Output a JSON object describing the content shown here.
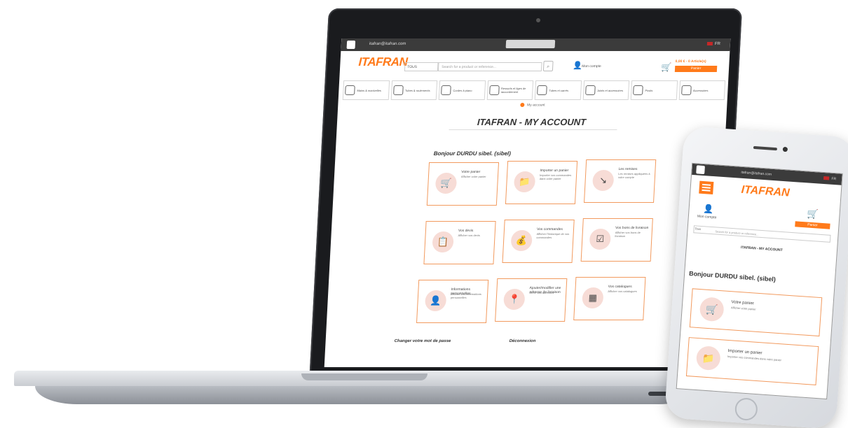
{
  "laptop": {
    "topbar": {
      "email": "itafran@itafran.com",
      "lang": "FR"
    },
    "brand": "ITAFRAN",
    "search": {
      "select": "TOUS",
      "placeholder": "Search for a product or reference..."
    },
    "account_label": "Mon compte",
    "cart": {
      "amount": "0,00 € · 0 Article(s)",
      "button": "Panier"
    },
    "categories": [
      "Mains & manivelles",
      "Tubes & roulements",
      "Cordes à piano",
      "Ressorts et tiges de raccordement",
      "Tubes et carrés",
      "Joints et accessoires",
      "Pivots",
      "Accessoires"
    ],
    "breadcrumb": "My account",
    "page_title": "ITAFRAN - MY ACCOUNT",
    "greeting": "Bonjour DURDU sibel. (sibel)",
    "tiles": [
      {
        "title": "Votre panier",
        "desc": "Afficher votre panier",
        "icon": "cart-icon",
        "glyph": "🛒"
      },
      {
        "title": "Importer un panier",
        "desc": "Importer vos commandes dans votre panier",
        "icon": "folder-icon",
        "glyph": "📁"
      },
      {
        "title": "Les remises",
        "desc": "Les remises appliquées à votre compte",
        "icon": "trend-icon",
        "glyph": "↘"
      },
      {
        "title": "Vos devis",
        "desc": "Afficher vos devis",
        "icon": "clipboard-icon",
        "glyph": "📋"
      },
      {
        "title": "Vos commandes",
        "desc": "Afficher l'historique de vos commandes",
        "icon": "coins-icon",
        "glyph": "💰"
      },
      {
        "title": "Vos bons de livraison",
        "desc": "Afficher vos bons de livraison",
        "icon": "checkbox-icon",
        "glyph": "☑"
      },
      {
        "title": "Informations personnelles",
        "desc": "Afficher vos informations personnelles",
        "icon": "user-icon",
        "glyph": "👤"
      },
      {
        "title": "Ajouter/modifier une adresse de livraison",
        "desc": "Gérer vos adresses",
        "icon": "location-icon",
        "glyph": "📍"
      },
      {
        "title": "Vos catalogues",
        "desc": "Afficher vos catalogues",
        "icon": "catalog-icon",
        "glyph": "▦"
      }
    ],
    "footer_left": "Changer votre mot de passe",
    "footer_right": "Déconnexion"
  },
  "phone": {
    "topbar": {
      "email": "itafran@itafran.com",
      "lang": "FR"
    },
    "brand": "ITAFRAN",
    "account_label": "Mon compte",
    "cart_button": "Panier",
    "search": {
      "select": "Tous",
      "placeholder": "Search for a product or reference..."
    },
    "page_title": "ITAFRAN - MY ACCOUNT",
    "greeting": "Bonjour DURDU sibel. (sibel)",
    "tiles": [
      {
        "title": "Votre panier",
        "desc": "Afficher votre panier",
        "glyph": "🛒"
      },
      {
        "title": "Importer un panier",
        "desc": "Importer vos commandes dans votre panier",
        "glyph": "📁"
      }
    ]
  },
  "colors": {
    "accent": "#ff7a1a",
    "tile_border": "#f29a5e",
    "circle": "#f7dcd6"
  }
}
